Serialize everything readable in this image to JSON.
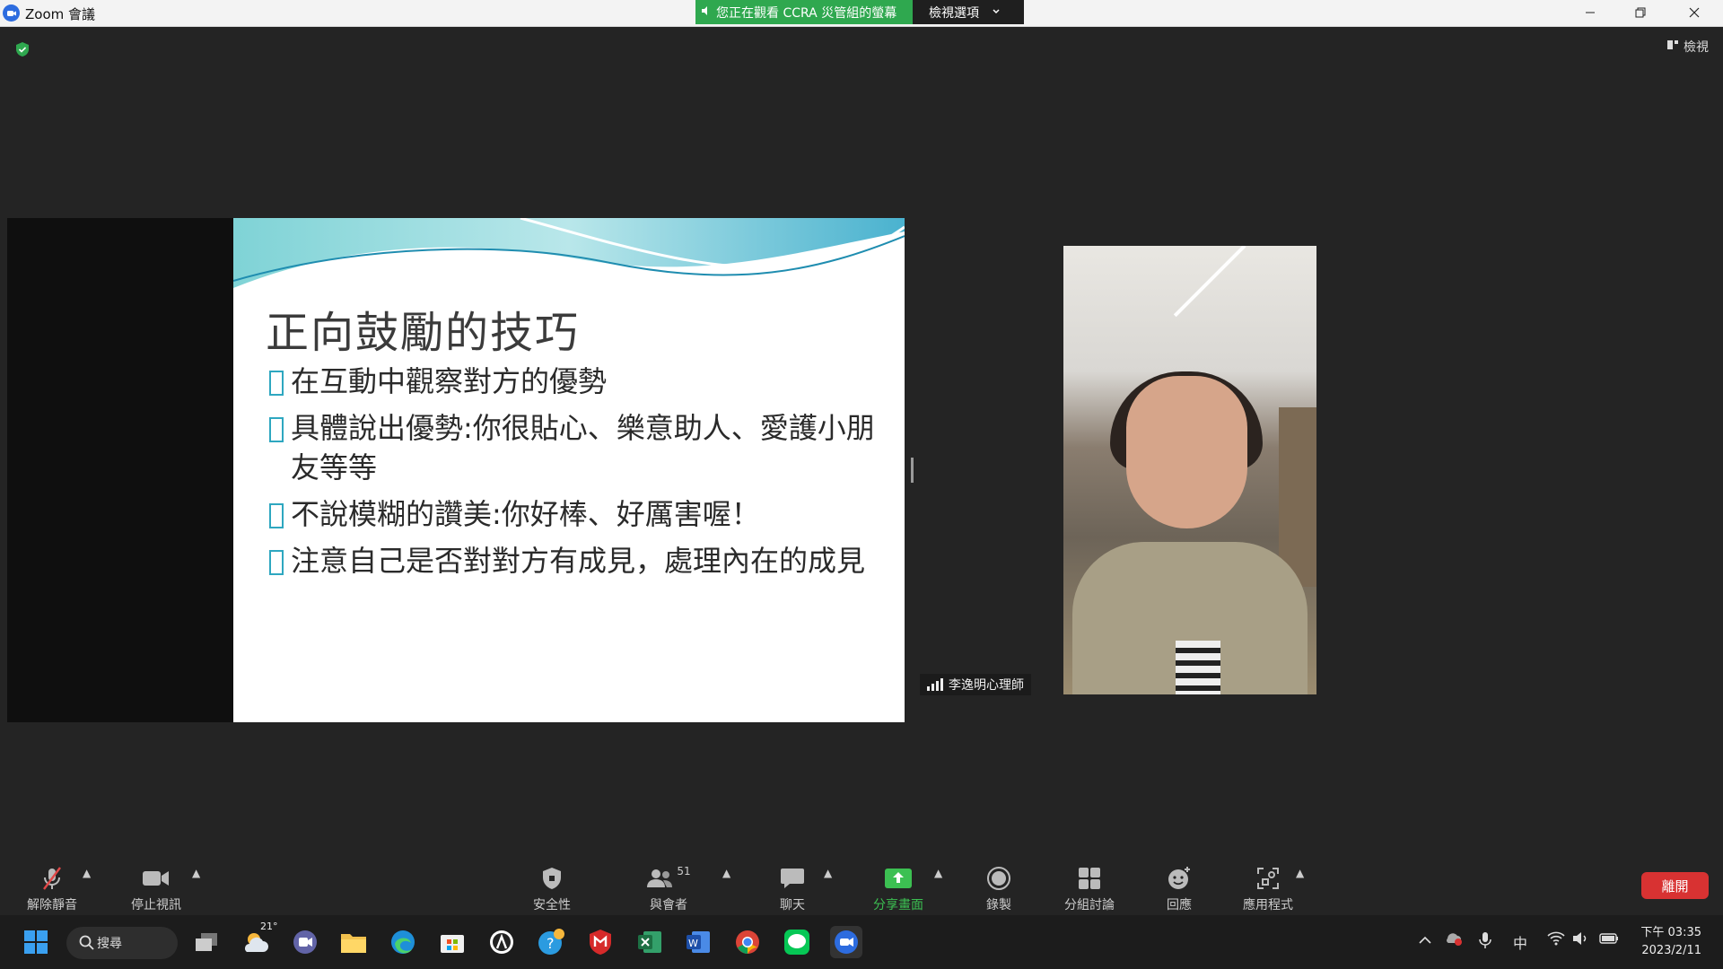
{
  "window": {
    "title": "Zoom 會議"
  },
  "share_banner": {
    "status": "您正在觀看 CCRA 災管組的螢幕",
    "view_options": "檢視選項"
  },
  "view_button": "檢視",
  "slide": {
    "title": "正向鼓勵的技巧",
    "bullets": [
      "在互動中觀察對方的優勢",
      "具體說出優勢:你很貼心、樂意助人、愛護小朋友等等",
      "不說模糊的讚美:你好棒、好厲害喔！",
      "注意自己是否對對方有成見，處理內在的成見"
    ]
  },
  "video": {
    "participant_name": "李逸明心理師"
  },
  "toolbar": {
    "unmute": "解除靜音",
    "stop_video": "停止視訊",
    "security": "安全性",
    "participants": "與會者",
    "participants_count": "51",
    "chat": "聊天",
    "share_screen": "分享畫面",
    "record": "錄製",
    "breakout": "分組討論",
    "reactions": "回應",
    "apps": "應用程式",
    "leave": "離開"
  },
  "taskbar": {
    "search": "搜尋",
    "weather": "21°",
    "input_method": "中",
    "time": "下午 03:35",
    "date": "2023/2/11"
  },
  "colors": {
    "share_green": "#2fa84f",
    "leave_red": "#d83232",
    "accent_teal": "#2ea7c0"
  }
}
